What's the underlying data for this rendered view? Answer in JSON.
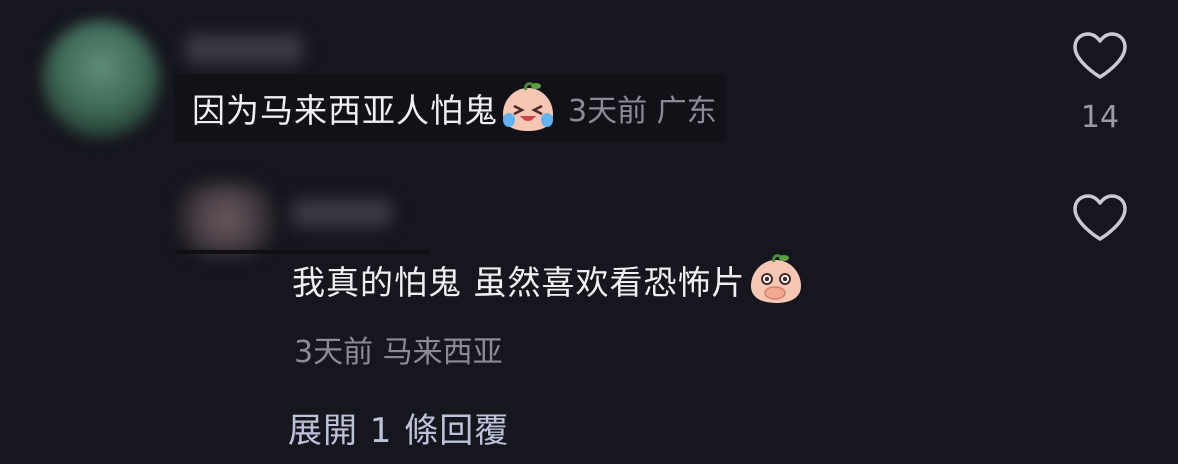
{
  "comments": [
    {
      "text": "因为马来西亚人怕鬼",
      "emoji_icon": "crying-laughing-peach-icon",
      "time": "3天前",
      "location": "广东",
      "like_count": "14"
    }
  ],
  "reply": {
    "text": "我真的怕鬼 虽然喜欢看恐怖片",
    "emoji_icon": "covering-mouth-peach-icon",
    "time": "3天前",
    "location": "马来西亚",
    "expand_label": "展開 1 條回覆"
  },
  "colors": {
    "background": "#16161e",
    "text": "#f0f0f3",
    "meta": "#8b8b95",
    "expand": "#bcc2d8"
  }
}
